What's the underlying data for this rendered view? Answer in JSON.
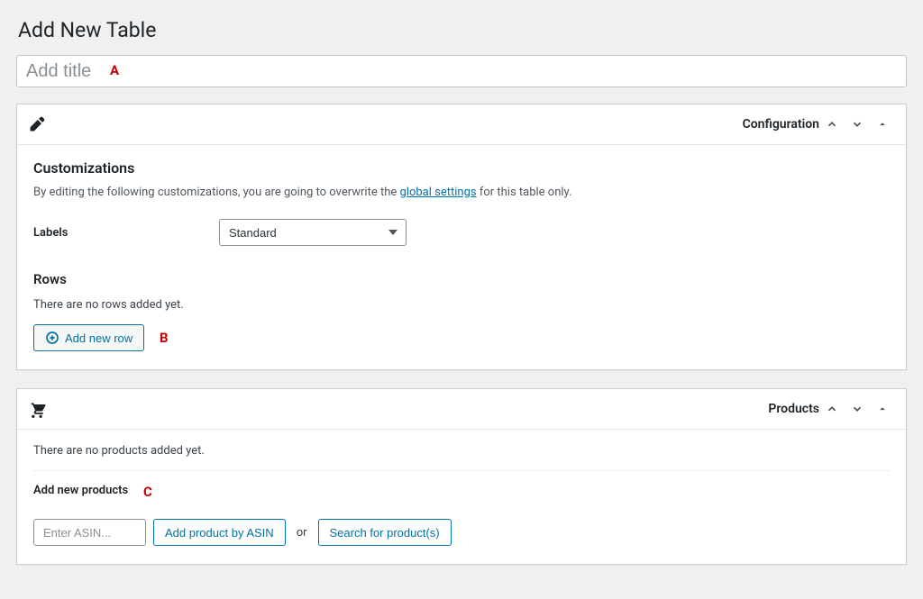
{
  "page": {
    "title": "Add New Table"
  },
  "title_field": {
    "placeholder": "Add title"
  },
  "annotations": {
    "a": "A",
    "b": "B",
    "c": "C"
  },
  "config_panel": {
    "title": "Configuration",
    "customizations_heading": "Customizations",
    "desc_before": "By editing the following customizations, you are going to overwrite the ",
    "desc_link": "global settings",
    "desc_after": " for this table only.",
    "labels_label": "Labels",
    "labels_value": "Standard",
    "rows_heading": "Rows",
    "rows_empty": "There are no rows added yet.",
    "add_row_btn": "Add new row"
  },
  "products_panel": {
    "title": "Products",
    "empty": "There are no products added yet.",
    "add_label": "Add new products",
    "asin_placeholder": "Enter ASIN...",
    "add_by_asin_btn": "Add product by ASIN",
    "or": "or",
    "search_btn": "Search for product(s)"
  }
}
